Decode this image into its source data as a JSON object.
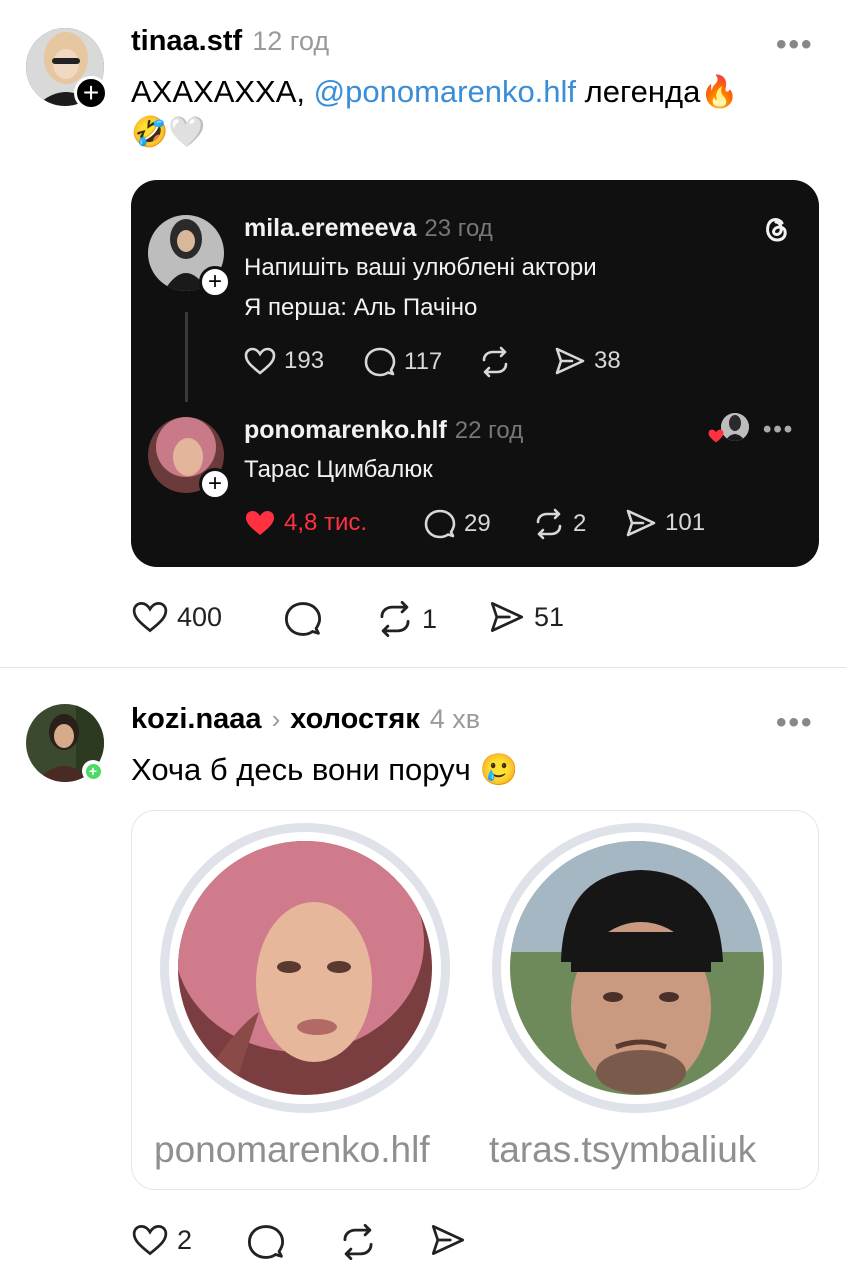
{
  "post1": {
    "username": "tinaa.stf",
    "time": "12 год",
    "text_prefix": "АХАХАХХА, ",
    "mention": "@ponomarenko.hlf",
    "text_suffix": "  легенда",
    "emoji_fire": "🔥",
    "emoji_line2": "🤣🤍",
    "more": "•••",
    "actions": {
      "likes": "400",
      "comments": "",
      "reposts": "1",
      "shares": "51"
    }
  },
  "quoted": {
    "threads_icon": "threads-logo-icon",
    "post": {
      "username": "mila.eremeeva",
      "time": "23 год",
      "line1": "Напишіть ваші улюблені актори",
      "line2": "Я перша: Аль Пачіно",
      "actions": {
        "likes": "193",
        "comments": "117",
        "reposts": "",
        "shares": "38"
      }
    },
    "reply": {
      "username": "ponomarenko.hlf",
      "time": "22 год",
      "text": "Тарас Цимбалюк",
      "more": "•••",
      "actions": {
        "likes": "4,8 тис.",
        "comments": "29",
        "reposts": "2",
        "shares": "101"
      },
      "like_color": "#ff3040"
    }
  },
  "post2": {
    "username": "kozi.naaa",
    "community": "холостяк",
    "time": "4 хв",
    "text": "Хоча б десь вони поруч ",
    "emoji": "🥲",
    "more": "•••",
    "profiles": [
      {
        "handle": "ponomarenko.hlf"
      },
      {
        "handle": "taras.tsymbaliuk"
      }
    ],
    "actions": {
      "likes": "2",
      "comments": "",
      "reposts": "",
      "shares": ""
    }
  },
  "colors": {
    "mention": "#3a8ed8",
    "like_red": "#ff3040",
    "online": "#4cd964"
  }
}
